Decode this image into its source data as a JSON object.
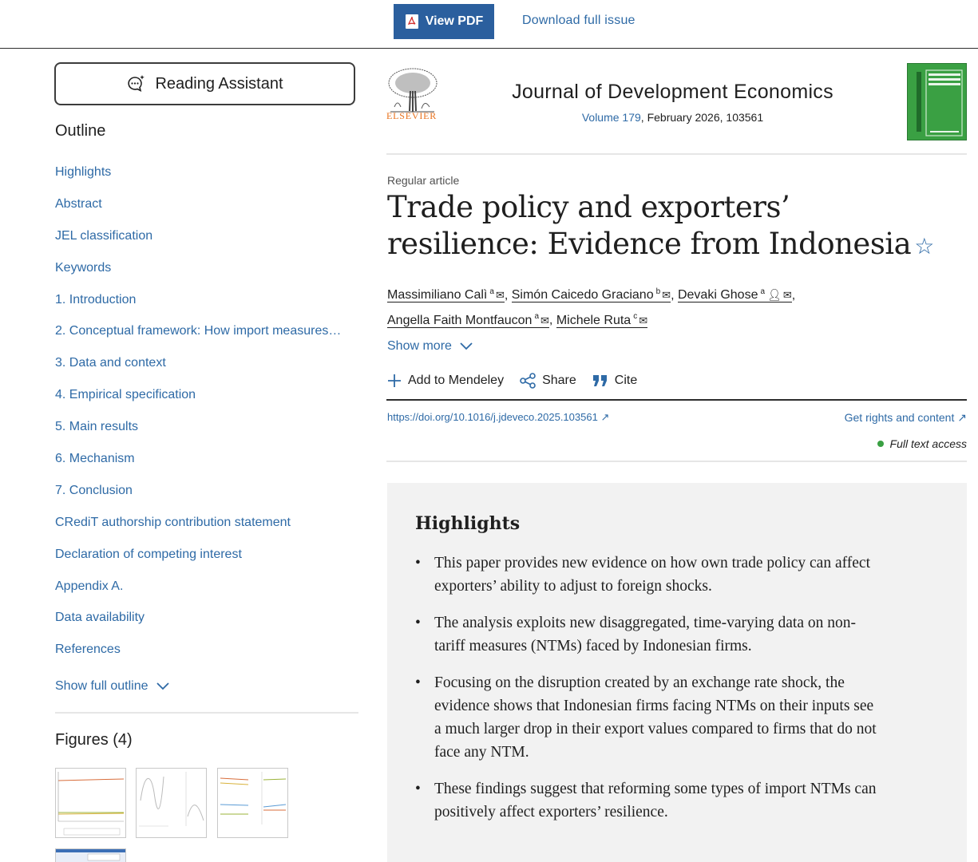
{
  "topbar": {
    "view_pdf": "View PDF",
    "download_issue": "Download full issue"
  },
  "sidebar": {
    "reading_assistant": "Reading Assistant",
    "outline_title": "Outline",
    "outline_items": [
      "Highlights",
      "Abstract",
      "JEL classification",
      "Keywords",
      "1. Introduction",
      "2. Conceptual framework: How import measures…",
      "3. Data and context",
      "4. Empirical specification",
      "5. Main results",
      "6. Mechanism",
      "7. Conclusion",
      "CRediT authorship contribution statement",
      "Declaration of competing interest",
      "Appendix A.",
      "Data availability",
      "References"
    ],
    "show_full_outline": "Show full outline",
    "figures_title": "Figures (4)"
  },
  "journal": {
    "publisher": "ELSEVIER",
    "title": "Journal of Development Economics",
    "volume_link": "Volume 179",
    "volume_rest": ", February 2026, 103561",
    "accent_color": "#2e6aa6",
    "cover_color": "#3aa043"
  },
  "article": {
    "type": "Regular article",
    "title": "Trade policy and exporters’ resilience: Evidence from Indonesia",
    "authors": [
      {
        "name": "Massimiliano Calì",
        "sup": "a"
      },
      {
        "name": "Simón Caicedo Graciano",
        "sup": "b"
      },
      {
        "name": "Devaki Ghose",
        "sup": "a"
      },
      {
        "name": "Angella Faith Montfaucon",
        "sup": "a"
      },
      {
        "name": "Michele Ruta",
        "sup": "c"
      }
    ],
    "show_more": "Show more",
    "actions": {
      "mendeley": "Add to Mendeley",
      "share": "Share",
      "cite": "Cite"
    },
    "doi": "https://doi.org/10.1016/j.jdeveco.2025.103561",
    "rights": "Get rights and content",
    "access": "Full text access"
  },
  "highlights": {
    "title": "Highlights",
    "items": [
      "This paper provides new evidence on how own trade policy can affect exporters’ ability to adjust to foreign shocks.",
      "The analysis exploits new disaggregated, time-varying data on non-tariff measures (NTMs) faced by Indonesian firms.",
      "Focusing on the disruption created by an exchange rate shock, the evidence shows that Indonesian firms facing NTMs on their inputs see a much larger drop in their export values compared to firms that do not face any NTM.",
      "These findings suggest that reforming some types of import NTMs can positively affect exporters’ resilience."
    ]
  }
}
